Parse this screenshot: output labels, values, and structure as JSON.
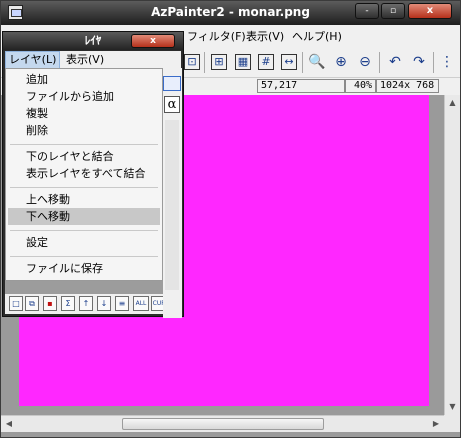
{
  "app": {
    "title": "AzPainter2 - monar.png",
    "caption_buttons": {
      "minimize": "-",
      "maximize": "▫",
      "close": "x"
    }
  },
  "main_menu": [
    {
      "label": "フィルタ(F)"
    },
    {
      "label": "表示(V)"
    },
    {
      "label": "ヘルプ(H)"
    }
  ],
  "toolbar": {
    "buttons": [
      {
        "name": "partial-toolbar-icon",
        "glyph": "⊡"
      },
      {
        "name": "grid-add-icon",
        "glyph": "⊞"
      },
      {
        "name": "dither-icon",
        "glyph": "▦"
      },
      {
        "name": "grid-icon",
        "glyph": "#"
      },
      {
        "name": "fit-width-icon",
        "glyph": "↔"
      },
      {
        "name": "zoom-icon",
        "glyph": "🔍"
      },
      {
        "name": "zoom-in-icon",
        "glyph": "⊕"
      },
      {
        "name": "zoom-out-icon",
        "glyph": "⊖"
      },
      {
        "name": "undo-icon",
        "glyph": "↶"
      },
      {
        "name": "redo-icon",
        "glyph": "↷"
      },
      {
        "name": "options-icon",
        "glyph": "⋮"
      }
    ]
  },
  "status": {
    "coords": "57,217",
    "zoom": "40%",
    "size": "1024x 768"
  },
  "canvas": {
    "color": "#ff27ff"
  },
  "layer_window": {
    "title": "ﾚｲﾔ",
    "close": "x",
    "menu": [
      {
        "label": "レイヤ(L)"
      },
      {
        "label": "表示(V)"
      }
    ],
    "peek_glyph": "α",
    "toolbar": [
      {
        "name": "new-layer-icon",
        "glyph": "□"
      },
      {
        "name": "copy-layer-icon",
        "glyph": "⧉"
      },
      {
        "name": "delete-layer-icon",
        "glyph": "▪"
      },
      {
        "name": "merge-layer-icon",
        "glyph": "Σ"
      },
      {
        "name": "move-up-icon",
        "glyph": "↑"
      },
      {
        "name": "move-down-icon",
        "glyph": "↓"
      },
      {
        "name": "properties-icon",
        "glyph": "≡"
      },
      {
        "name": "all-label-icon",
        "glyph": "ALL"
      },
      {
        "name": "cur-label-icon",
        "glyph": "CUR"
      }
    ]
  },
  "layer_menu": {
    "groups": [
      [
        "追加",
        "ファイルから追加",
        "複製",
        "削除"
      ],
      [
        "下のレイヤと結合",
        "表示レイヤをすべて結合"
      ],
      [
        "上へ移動",
        "下へ移動"
      ],
      [
        "設定"
      ],
      [
        "ファイルに保存"
      ]
    ],
    "highlighted": "下へ移動"
  }
}
